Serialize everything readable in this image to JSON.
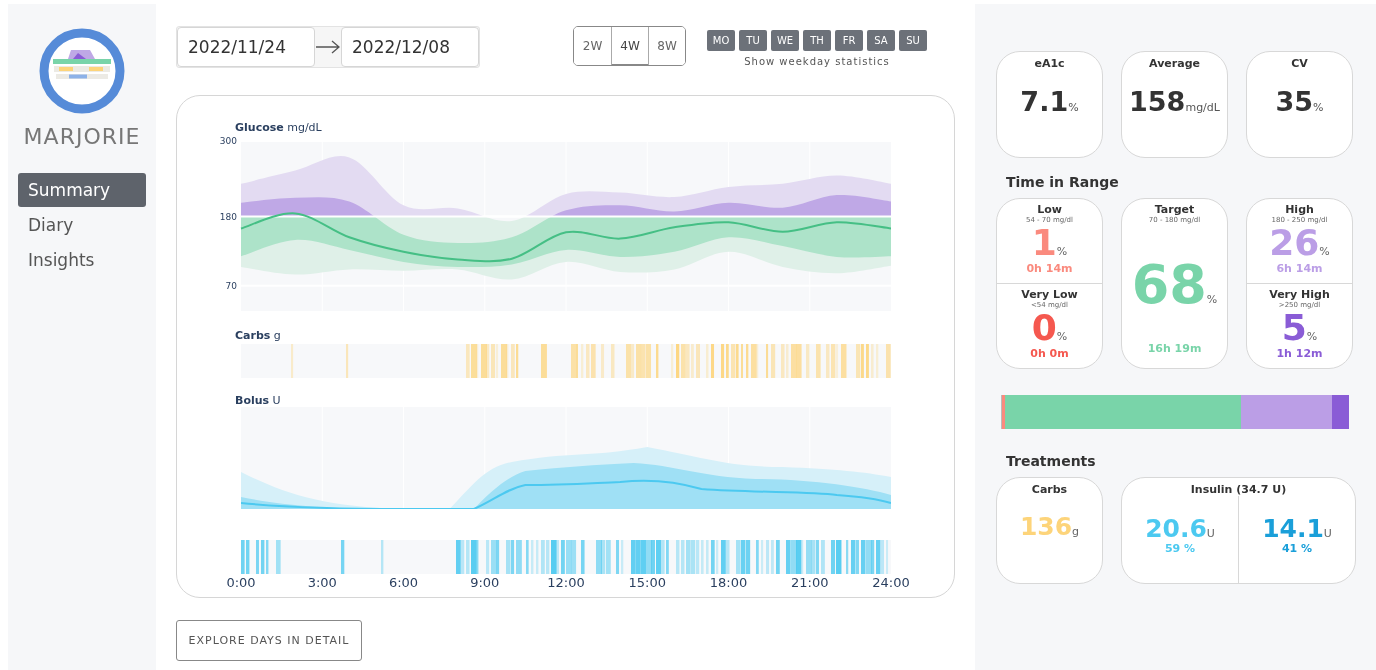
{
  "sidebar": {
    "brand": "MARJORIE",
    "items": [
      {
        "label": "Summary",
        "selected": true
      },
      {
        "label": "Diary",
        "selected": false
      },
      {
        "label": "Insights",
        "selected": false
      }
    ]
  },
  "date_range": {
    "start": "2022/11/24",
    "end": "2022/12/08"
  },
  "periods": [
    {
      "label": "2W",
      "selected": false
    },
    {
      "label": "4W",
      "selected": true
    },
    {
      "label": "8W",
      "selected": false
    }
  ],
  "weekdays": {
    "caption": "Show weekday statistics",
    "days": [
      {
        "label": "MO",
        "selected": true
      },
      {
        "label": "TU",
        "selected": true
      },
      {
        "label": "WE",
        "selected": true
      },
      {
        "label": "TH",
        "selected": true
      },
      {
        "label": "FR",
        "selected": true
      },
      {
        "label": "SA",
        "selected": true
      },
      {
        "label": "SU",
        "selected": true
      }
    ]
  },
  "glucose": {
    "title": "Glucose",
    "unit": "mg/dL",
    "yticks": [
      "300",
      "180",
      "70"
    ]
  },
  "carbs": {
    "title": "Carbs",
    "unit": "g"
  },
  "bolus": {
    "title": "Bolus",
    "unit": "U"
  },
  "time_axis": [
    "0:00",
    "3:00",
    "6:00",
    "9:00",
    "12:00",
    "15:00",
    "18:00",
    "21:00",
    "24:00"
  ],
  "explore_button": "EXPLORE DAYS IN DETAIL",
  "summary": [
    {
      "label": "eA1c",
      "value": "7.1",
      "unit": "%"
    },
    {
      "label": "Average",
      "value": "158",
      "unit": "mg/dL"
    },
    {
      "label": "CV",
      "value": "35",
      "unit": "%"
    }
  ],
  "time_in_range": {
    "title": "Time in Range",
    "columns": [
      [
        {
          "label": "Low",
          "range": "54 - 70 mg/dl",
          "value": "1",
          "unit": "%",
          "duration": "0h 14m",
          "color": "#fa8a7e"
        },
        {
          "label": "Very Low",
          "range": "<54 mg/dl",
          "value": "0",
          "unit": "%",
          "duration": "0h 0m",
          "color": "#f5584f"
        }
      ],
      [
        {
          "label": "Target",
          "range": "70 - 180 mg/dl",
          "value": "68",
          "unit": "%",
          "duration": "16h 19m",
          "color": "#79d4a9"
        }
      ],
      [
        {
          "label": "High",
          "range": "180 - 250 mg/dl",
          "value": "26",
          "unit": "%",
          "duration": "6h 14m",
          "color": "#bb9ee6"
        },
        {
          "label": "Very High",
          "range": ">250 mg/dl",
          "value": "5",
          "unit": "%",
          "duration": "1h 12m",
          "color": "#8a5cd6"
        }
      ]
    ]
  },
  "treatments": {
    "title": "Treatments",
    "carbs": {
      "label": "Carbs",
      "value": "136",
      "unit": "g",
      "color": "#fdd47a"
    },
    "insulin": {
      "label": "Insulin (34.7 U)",
      "parts": [
        {
          "value": "20.6",
          "unit": "U",
          "share": "59 %",
          "color": "#4cc9f0"
        },
        {
          "value": "14.1",
          "unit": "U",
          "share": "41 %",
          "color": "#1a9fd9"
        }
      ]
    }
  }
}
